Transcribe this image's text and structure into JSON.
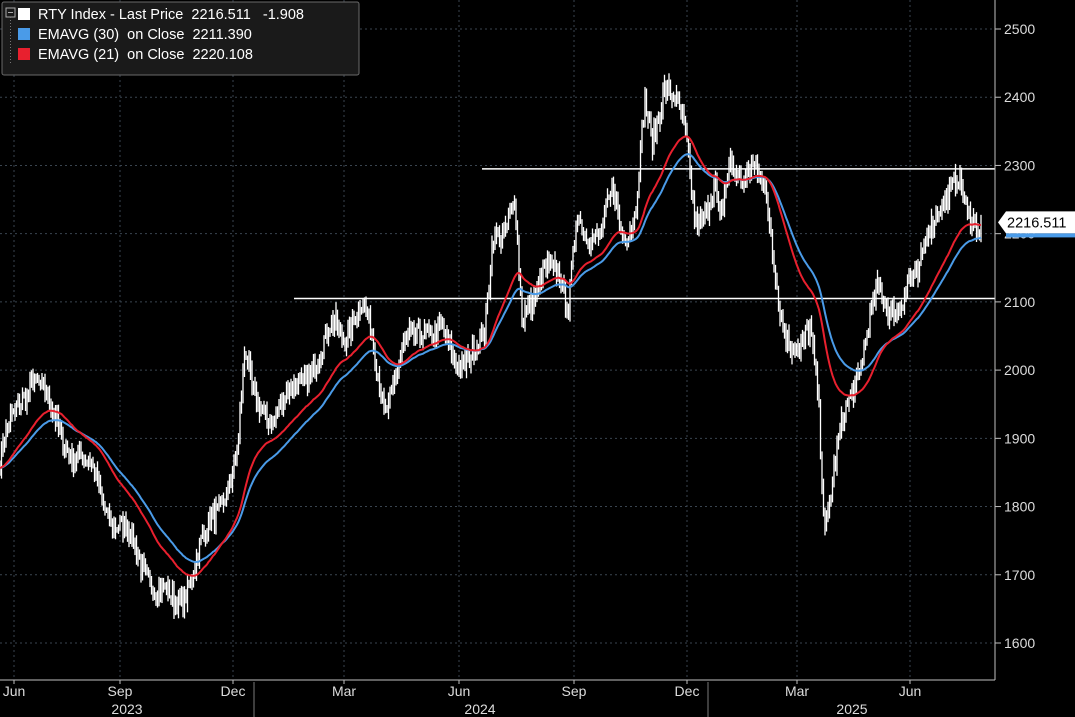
{
  "chart_data": {
    "type": "line",
    "ticker": "RTY Index",
    "legend": [
      {
        "label": "RTY Index - Last Price",
        "value": "2216.511",
        "change": "-1.908",
        "color": "#ffffff"
      },
      {
        "label": "EMAVG (30)  on Close",
        "value": "2211.390",
        "color": "#4a9be8"
      },
      {
        "label": "EMAVG (21)  on Close",
        "value": "2220.108",
        "color": "#e8202e"
      }
    ],
    "last_price_label": "2216.511",
    "ylim": [
      1540,
      2530
    ],
    "y_ticks": [
      1600,
      1700,
      1800,
      1900,
      2000,
      2100,
      2200,
      2300,
      2400,
      2500
    ],
    "x_ticks": [
      "Jun",
      "Sep",
      "Dec",
      "Mar",
      "Jun",
      "Sep",
      "Dec",
      "Mar",
      "Jun"
    ],
    "x_years": [
      "2023",
      "2024",
      "2025"
    ],
    "horizontal_lines": [
      2295,
      2105
    ],
    "anchors": [
      [
        0,
        1870
      ],
      [
        22,
        1960
      ],
      [
        33,
        2000
      ],
      [
        55,
        1920
      ],
      [
        75,
        1880
      ],
      [
        95,
        1840
      ],
      [
        110,
        1790
      ],
      [
        125,
        1760
      ],
      [
        145,
        1710
      ],
      [
        158,
        1680
      ],
      [
        175,
        1650
      ],
      [
        185,
        1680
      ],
      [
        200,
        1740
      ],
      [
        215,
        1780
      ],
      [
        228,
        1840
      ],
      [
        238,
        1890
      ],
      [
        245,
        2020
      ],
      [
        252,
        1960
      ],
      [
        262,
        1950
      ],
      [
        275,
        1930
      ],
      [
        290,
        1960
      ],
      [
        305,
        2000
      ],
      [
        318,
        2010
      ],
      [
        335,
        2070
      ],
      [
        345,
        2060
      ],
      [
        355,
        2080
      ],
      [
        362,
        2090
      ],
      [
        372,
        2040
      ],
      [
        385,
        1950
      ],
      [
        398,
        2000
      ],
      [
        410,
        2040
      ],
      [
        425,
        2070
      ],
      [
        440,
        2050
      ],
      [
        455,
        2010
      ],
      [
        470,
        2030
      ],
      [
        485,
        2040
      ],
      [
        493,
        2190
      ],
      [
        505,
        2220
      ],
      [
        515,
        2250
      ],
      [
        522,
        2060
      ],
      [
        532,
        2090
      ],
      [
        545,
        2170
      ],
      [
        557,
        2140
      ],
      [
        568,
        2070
      ],
      [
        577,
        2240
      ],
      [
        590,
        2200
      ],
      [
        600,
        2180
      ],
      [
        614,
        2270
      ],
      [
        622,
        2210
      ],
      [
        635,
        2220
      ],
      [
        645,
        2380
      ],
      [
        652,
        2330
      ],
      [
        665,
        2430
      ],
      [
        676,
        2390
      ],
      [
        686,
        2330
      ],
      [
        695,
        2220
      ],
      [
        705,
        2240
      ],
      [
        715,
        2270
      ],
      [
        720,
        2200
      ],
      [
        730,
        2300
      ],
      [
        742,
        2290
      ],
      [
        752,
        2300
      ],
      [
        760,
        2280
      ],
      [
        770,
        2210
      ],
      [
        780,
        2100
      ],
      [
        790,
        2040
      ],
      [
        800,
        2010
      ],
      [
        810,
        2060
      ],
      [
        818,
        1980
      ],
      [
        825,
        1770
      ],
      [
        833,
        1840
      ],
      [
        845,
        1930
      ],
      [
        858,
        2000
      ],
      [
        868,
        2070
      ],
      [
        878,
        2110
      ],
      [
        888,
        2080
      ],
      [
        898,
        2100
      ],
      [
        908,
        2140
      ],
      [
        918,
        2120
      ],
      [
        928,
        2200
      ],
      [
        938,
        2250
      ],
      [
        948,
        2260
      ],
      [
        958,
        2270
      ],
      [
        968,
        2220
      ],
      [
        975,
        2230
      ],
      [
        982,
        2216.511
      ]
    ],
    "noise_amplitude": 28,
    "x_start": 0,
    "x_end": 982,
    "ema_spans": {
      "ema30": 30,
      "ema21": 21
    }
  }
}
